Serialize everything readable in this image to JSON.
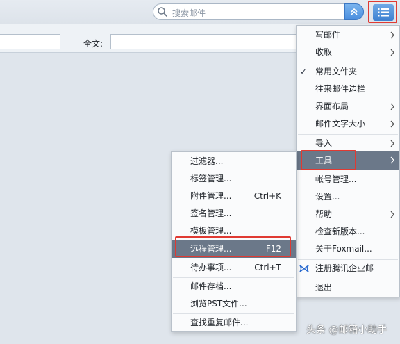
{
  "search": {
    "placeholder": "搜索邮件",
    "toggle_icon": "double-chevron-up-icon"
  },
  "menu_button": {
    "icon": "list-menu-icon"
  },
  "filter": {
    "fulltext_label": "全文:"
  },
  "main_menu": {
    "items": [
      {
        "label": "写邮件",
        "submenu": true
      },
      {
        "label": "收取",
        "submenu": true
      },
      {
        "label": "常用文件夹",
        "checked": true
      },
      {
        "label": "往来邮件边栏"
      },
      {
        "label": "界面布局",
        "submenu": true
      },
      {
        "label": "邮件文字大小",
        "submenu": true
      },
      {
        "label": "导入",
        "submenu": true
      },
      {
        "label": "工具",
        "submenu": true,
        "highlighted": true
      },
      {
        "label": "帐号管理..."
      },
      {
        "label": "设置..."
      },
      {
        "label": "帮助",
        "submenu": true
      },
      {
        "label": "检查新版本..."
      },
      {
        "label": "关于Foxmail..."
      },
      {
        "label": "注册腾讯企业邮",
        "icon": "tencent-bowtie-icon"
      },
      {
        "label": "退出"
      }
    ]
  },
  "tools_menu": {
    "items": [
      {
        "label": "过滤器..."
      },
      {
        "label": "标签管理..."
      },
      {
        "label": "附件管理...",
        "shortcut": "Ctrl+K"
      },
      {
        "label": "签名管理..."
      },
      {
        "label": "模板管理..."
      },
      {
        "label": "远程管理...",
        "shortcut": "F12",
        "highlighted": true
      },
      {
        "label": "待办事项...",
        "shortcut": "Ctrl+T"
      },
      {
        "label": "邮件存档..."
      },
      {
        "label": "浏览PST文件..."
      },
      {
        "label": "查找重复邮件..."
      }
    ]
  },
  "watermark": {
    "text": "头条 @邮箱小助手"
  },
  "colors": {
    "highlight": "#6b7889",
    "accent": "#3d80d1",
    "annotation": "#e03a32"
  }
}
